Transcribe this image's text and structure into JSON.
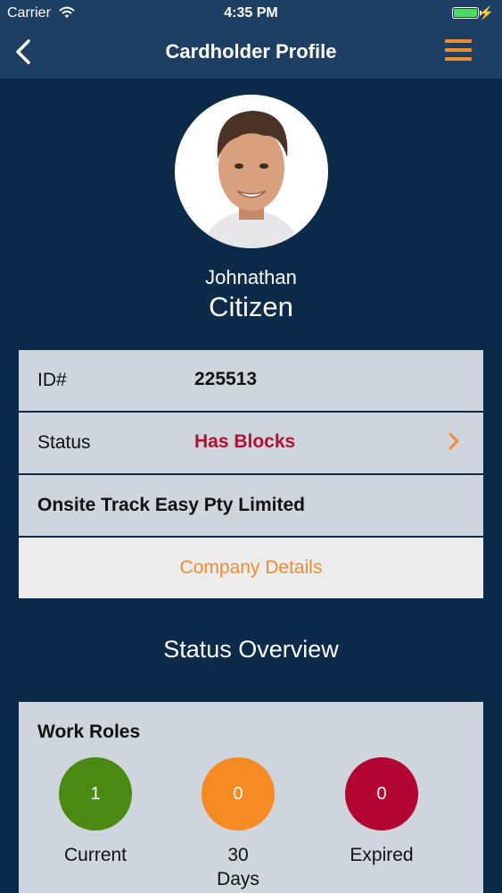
{
  "status_bar": {
    "carrier": "Carrier",
    "time": "4:35 PM",
    "battery_level": 1.0
  },
  "nav": {
    "title": "Cardholder Profile",
    "back_icon": "chevron-left-icon",
    "menu_icon": "hamburger-menu-icon"
  },
  "profile": {
    "first_name": "Johnathan",
    "last_name": "Citizen"
  },
  "details": {
    "id_label": "ID#",
    "id_value": "225513",
    "status_label": "Status",
    "status_value": "Has Blocks",
    "company_name": "Onsite Track Easy Pty Limited",
    "company_details_link": "Company Details"
  },
  "overview": {
    "title": "Status Overview",
    "work_roles": {
      "title": "Work Roles",
      "items": [
        {
          "count": "1",
          "label": "Current",
          "color": "#4a8a12"
        },
        {
          "count": "0",
          "label": "30\nDays",
          "color": "#f68b24"
        },
        {
          "count": "0",
          "label": "Expired",
          "color": "#b30632"
        }
      ]
    }
  },
  "colors": {
    "background": "#0c2b4b",
    "header": "#1c3f63",
    "accent": "#f08c2b",
    "alert": "#b01231"
  }
}
